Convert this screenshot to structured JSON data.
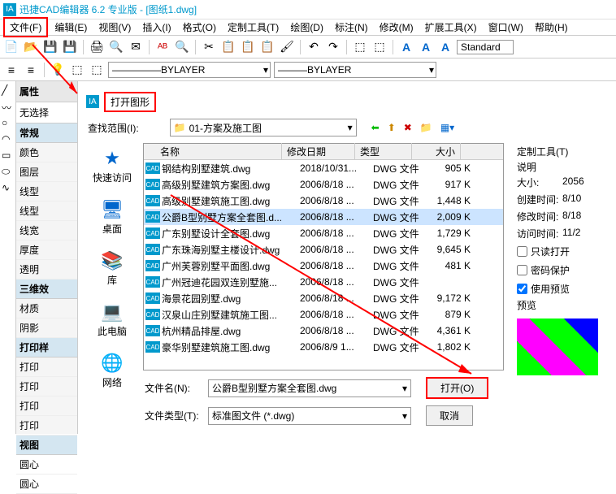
{
  "title": "迅捷CAD编辑器 6.2 专业版 - [图纸1.dwg]",
  "menu": [
    "文件(F)",
    "编辑(E)",
    "视图(V)",
    "插入(I)",
    "格式(O)",
    "定制工具(T)",
    "绘图(D)",
    "标注(N)",
    "修改(M)",
    "扩展工具(X)",
    "窗口(W)",
    "帮助(H)"
  ],
  "font_style": "Standard",
  "layer_by1": "BYLAYER",
  "layer_by2": "BYLAYER",
  "prop": {
    "header": "属性",
    "nosel": "无选择",
    "groups": {
      "general": "常规",
      "general_rows": [
        "颜色",
        "图层",
        "线型",
        "线型",
        "线宽",
        "厚度",
        "透明"
      ],
      "effect": "三维效",
      "effect_rows": [
        "材质",
        "阴影"
      ],
      "print": "打印样",
      "print_rows": [
        "打印",
        "打印",
        "打印",
        "打印"
      ],
      "view": "视图",
      "view_rows": [
        "圆心",
        "圆心"
      ]
    }
  },
  "dialog": {
    "title": "打开图形",
    "lookup_label": "查找范围(I):",
    "folder": "01-方案及施工图",
    "places": [
      {
        "icon": "★",
        "label": "快速访问"
      },
      {
        "icon": "🖥",
        "label": "桌面"
      },
      {
        "icon": "📚",
        "label": "库"
      },
      {
        "icon": "💻",
        "label": "此电脑"
      },
      {
        "icon": "🌐",
        "label": "网络"
      }
    ],
    "columns": {
      "name": "名称",
      "date": "修改日期",
      "type": "类型",
      "size": "大小"
    },
    "files": [
      {
        "name": "钢结构别墅建筑.dwg",
        "date": "2018/10/31...",
        "type": "DWG 文件",
        "size": "905 K"
      },
      {
        "name": "高级别墅建筑方案图.dwg",
        "date": "2006/8/18 ...",
        "type": "DWG 文件",
        "size": "917 K"
      },
      {
        "name": "高级别墅建筑施工图.dwg",
        "date": "2006/8/18 ...",
        "type": "DWG 文件",
        "size": "1,448 K"
      },
      {
        "name": "公爵B型别墅方案全套图.d...",
        "date": "2006/8/18 ...",
        "type": "DWG 文件",
        "size": "2,009 K",
        "selected": true
      },
      {
        "name": "广东别墅设计全套图.dwg",
        "date": "2006/8/18 ...",
        "type": "DWG 文件",
        "size": "1,729 K"
      },
      {
        "name": "广东珠海别墅主楼设计.dwg",
        "date": "2006/8/18 ...",
        "type": "DWG 文件",
        "size": "9,645 K"
      },
      {
        "name": "广州芙蓉别墅平面图.dwg",
        "date": "2006/8/18 ...",
        "type": "DWG 文件",
        "size": "481 K"
      },
      {
        "name": "广州冠迪花园双连别墅施...",
        "date": "2006/8/18 ...",
        "type": "DWG 文件",
        "size": ""
      },
      {
        "name": "海景花园别墅.dwg",
        "date": "2006/8/18 ...",
        "type": "DWG 文件",
        "size": "9,172 K"
      },
      {
        "name": "汉泉山庄别墅建筑施工图...",
        "date": "2006/8/18 ...",
        "type": "DWG 文件",
        "size": "879 K"
      },
      {
        "name": "杭州精品排屋.dwg",
        "date": "2006/8/18 ...",
        "type": "DWG 文件",
        "size": "4,361 K"
      },
      {
        "name": "豪华别墅建筑施工图.dwg",
        "date": "2006/8/9 1...",
        "type": "DWG 文件",
        "size": "1,802 K"
      }
    ],
    "filename_label": "文件名(N):",
    "filename_value": "公爵B型别墅方案全套图.dwg",
    "filetype_label": "文件类型(T):",
    "filetype_value": "标准图文件 (*.dwg)",
    "open_btn": "打开(O)",
    "cancel_btn": "取消",
    "right": {
      "header": "定制工具(T)",
      "desc": "说明",
      "size_lbl": "大小:",
      "size_val": "2056",
      "created_lbl": "创建时间:",
      "created_val": "8/10",
      "modified_lbl": "修改时间:",
      "modified_val": "8/18",
      "accessed_lbl": "访问时间:",
      "accessed_val": "11/2",
      "readonly": "只读打开",
      "password": "密码保护",
      "preview_chk": "使用预览",
      "preview_lbl": "预览"
    }
  }
}
